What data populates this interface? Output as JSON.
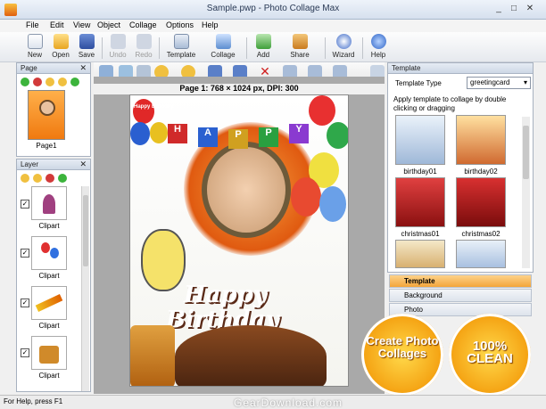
{
  "window": {
    "title": "Sample.pwp - Photo Collage Max",
    "min": "_",
    "max": "□",
    "close": "✕"
  },
  "menu": [
    "File",
    "Edit",
    "View",
    "Object",
    "Collage",
    "Options",
    "Help"
  ],
  "toolbar": {
    "new": "New",
    "open": "Open",
    "save": "Save",
    "undo": "Undo",
    "redo": "Redo",
    "template": "Template",
    "collage": "Collage",
    "add": "Add",
    "share": "Share",
    "wizard": "Wizard",
    "help": "Help"
  },
  "page_panel": {
    "title": "Page",
    "close": "✕",
    "thumb_label": "Page1"
  },
  "layer_panel": {
    "title": "Layer",
    "close": "✕",
    "items": [
      "Clipart",
      "Clipart",
      "Clipart",
      "Clipart"
    ]
  },
  "canvas": {
    "page_info": "Page 1: 768 × 1024 px, DPI: 300",
    "balloon_text": "Happy Birthday",
    "happy_letters": [
      "H",
      "A",
      "P",
      "P",
      "Y"
    ],
    "cake_text_1": "Happy",
    "cake_text_2": "Birthday"
  },
  "template_panel": {
    "title": "Template",
    "type_label": "Template Type",
    "type_value": "greetingcard",
    "desc": "Apply template to collage by double clicking or dragging",
    "thumbs": [
      "birthday01",
      "birthday02",
      "christmas01",
      "christmas02"
    ]
  },
  "accordion": [
    "Template",
    "Background",
    "Photo"
  ],
  "status": {
    "text": "For Help, press F1"
  },
  "badges": {
    "left": "Create Photo Collages",
    "right": "100% CLEAN"
  },
  "watermark": "GearDownload.com"
}
